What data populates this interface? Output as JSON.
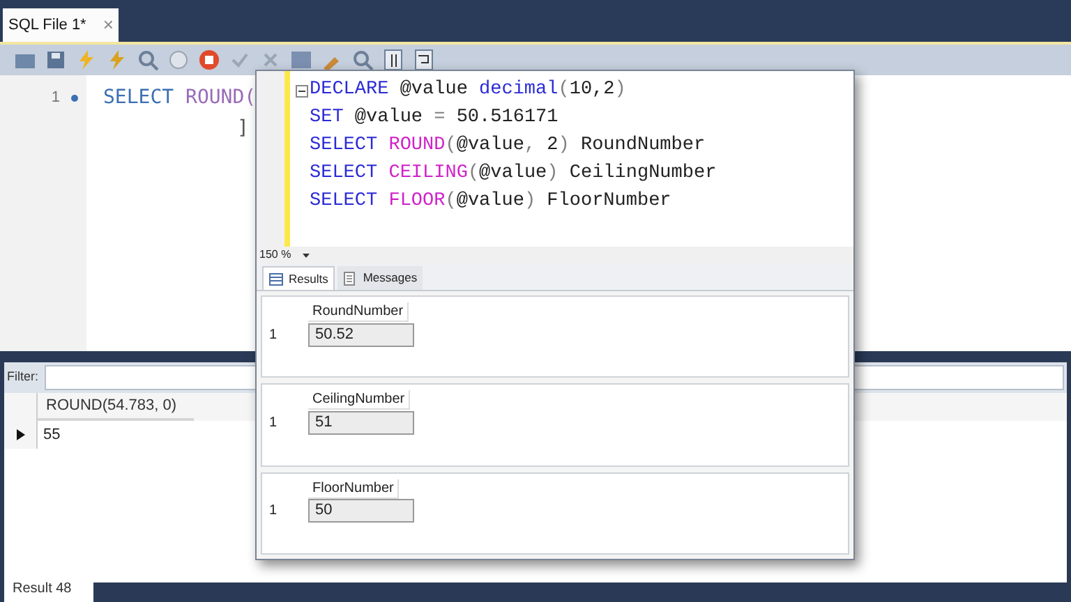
{
  "editor_tab": {
    "title": "SQL File 1*",
    "close": "×"
  },
  "editor": {
    "lines": [
      {
        "number": "1",
        "tokens": [
          {
            "kind": "keyword",
            "text": "SELECT "
          },
          {
            "kind": "function",
            "text": "ROUND("
          }
        ]
      },
      {
        "tokens": [
          {
            "kind": "plain",
            "text": "]"
          }
        ]
      }
    ]
  },
  "filter": {
    "label": "Filter:"
  },
  "result_grid": {
    "columns": [
      "ROUND(54.783, 0)"
    ],
    "rows": [
      [
        "55"
      ]
    ]
  },
  "status_bar": {
    "text": "Result 48"
  },
  "overlay": {
    "code": [
      [
        {
          "kind": "keyword",
          "text": "DECLARE"
        },
        {
          "kind": "plain",
          "text": " @value "
        },
        {
          "kind": "keyword",
          "text": "decimal"
        },
        {
          "kind": "punct",
          "text": "("
        },
        {
          "kind": "plain",
          "text": "10,2"
        },
        {
          "kind": "punct",
          "text": ")"
        }
      ],
      [
        {
          "kind": "keyword",
          "text": "SET"
        },
        {
          "kind": "plain",
          "text": " @value "
        },
        {
          "kind": "punct",
          "text": "="
        },
        {
          "kind": "plain",
          "text": " 50.516171"
        }
      ],
      [
        {
          "kind": "keyword",
          "text": "SELECT "
        },
        {
          "kind": "function",
          "text": "ROUND"
        },
        {
          "kind": "punct",
          "text": "("
        },
        {
          "kind": "plain",
          "text": "@value"
        },
        {
          "kind": "punct",
          "text": ","
        },
        {
          "kind": "plain",
          "text": " 2"
        },
        {
          "kind": "punct",
          "text": ")"
        },
        {
          "kind": "plain",
          "text": " RoundNumber"
        }
      ],
      [
        {
          "kind": "keyword",
          "text": "SELECT "
        },
        {
          "kind": "function",
          "text": "CEILING"
        },
        {
          "kind": "punct",
          "text": "("
        },
        {
          "kind": "plain",
          "text": "@value"
        },
        {
          "kind": "punct",
          "text": ")"
        },
        {
          "kind": "plain",
          "text": " CeilingNumber"
        }
      ],
      [
        {
          "kind": "keyword",
          "text": "SELECT "
        },
        {
          "kind": "function",
          "text": "FLOOR"
        },
        {
          "kind": "punct",
          "text": "("
        },
        {
          "kind": "plain",
          "text": "@value"
        },
        {
          "kind": "punct",
          "text": ")"
        },
        {
          "kind": "plain",
          "text": " FloorNumber"
        }
      ]
    ],
    "zoom": "150 %",
    "tabs": [
      {
        "label": "Results",
        "selected": true
      },
      {
        "label": "Messages",
        "selected": false
      }
    ],
    "results": [
      {
        "column": "RoundNumber",
        "row": "1",
        "value": "50.52"
      },
      {
        "column": "CeilingNumber",
        "row": "1",
        "value": "51"
      },
      {
        "column": "FloorNumber",
        "row": "1",
        "value": "50"
      }
    ]
  }
}
